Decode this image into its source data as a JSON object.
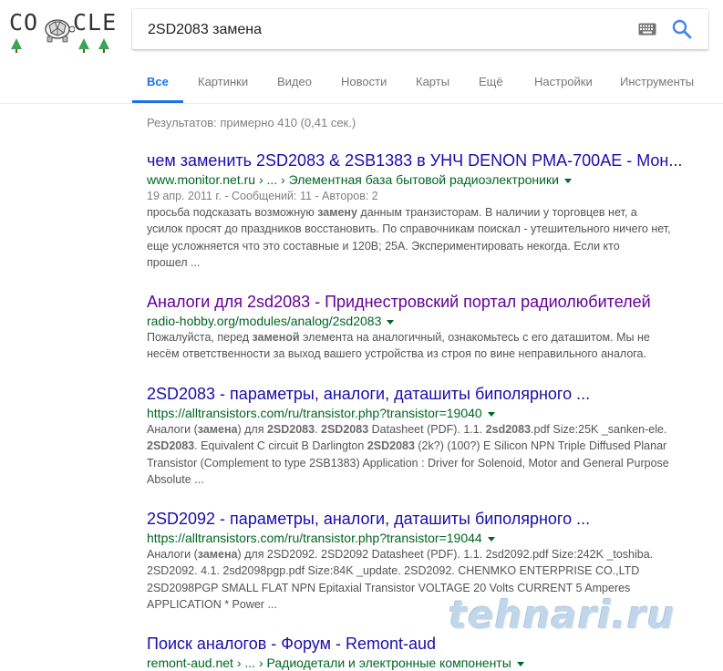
{
  "logo": {
    "left_text": "CO",
    "right_text": "CLE"
  },
  "search": {
    "query": "2SD2083 замена"
  },
  "tabs": [
    {
      "label": "Все"
    },
    {
      "label": "Картинки"
    },
    {
      "label": "Видео"
    },
    {
      "label": "Новости"
    },
    {
      "label": "Карты"
    },
    {
      "label": "Ещё"
    },
    {
      "label": "Настройки"
    },
    {
      "label": "Инструменты"
    }
  ],
  "stats": "Результатов: примерно 410 (0,41 сек.)",
  "results": [
    {
      "title": "чем заменить 2SD2083 & 2SB1383 в УНЧ DENON PMA-700AE - Мон...",
      "url": "www.monitor.net.ru › ... › Элементная база бытовой радиоэлектроники",
      "meta": "19 апр. 2011 г. - Сообщений: 11 - Авторов: 2",
      "snippet": [
        [
          "просьба подсказать возможную ",
          "замену",
          " данным транзисторам. В наличии у торговцев нет, а"
        ],
        [
          "усилок просят до праздников восстановить. По справочникам поискал - утешительного ничего нет,"
        ],
        [
          "еще усложняется что это составные и 120В; 25А. Экспериментировать некогда. Если кто"
        ],
        [
          "прошел ..."
        ]
      ]
    },
    {
      "title": "Аналоги для 2sd2083 - Приднестровский портал радиолюбителей",
      "url": "radio-hobby.org/modules/analog/2sd2083",
      "snippet": [
        [
          "Пожалуйста, перед ",
          "заменой",
          " элемента на аналогичный, ознакомьтесь с его даташитом. Мы не"
        ],
        [
          "несём ответственности за выход вашего устройства из строя по вине неправильного аналога."
        ]
      ]
    },
    {
      "title": "2SD2083 - параметры, аналоги, даташиты биполярного ...",
      "url": "https://alltransistors.com/ru/transistor.php?transistor=19040",
      "snippet": [
        [
          "Аналоги (",
          "замена",
          ") для ",
          "2SD2083",
          ". ",
          "2SD2083",
          " Datasheet (PDF). 1.1. ",
          "2sd2083",
          ".pdf Size:25K _sanken-ele."
        ],
        [
          "",
          "2SD2083",
          ". Equivalent C circuit B Darlington ",
          "2SD2083",
          " (2k?) (100?) E Silicon NPN Triple Diffused Planar"
        ],
        [
          "Transistor (Complement to type 2SB1383) Application : Driver for Solenoid, Motor and General Purpose"
        ],
        [
          "Absolute ..."
        ]
      ]
    },
    {
      "title": "2SD2092 - параметры, аналоги, даташиты биполярного ...",
      "url": "https://alltransistors.com/ru/transistor.php?transistor=19044",
      "snippet": [
        [
          "Аналоги (",
          "замена",
          ") для 2SD2092. 2SD2092 Datasheet (PDF). 1.1. 2sd2092.pdf Size:242K _toshiba."
        ],
        [
          "2SD2092. 4.1. 2sd2098pgp.pdf Size:84K _update. 2SD2092. CHENMKO ENTERPRISE CO.,LTD"
        ],
        [
          "2SD2098PGP SMALL FLAT NPN Epitaxial Transistor VOLTAGE 20 Volts CURRENT 5 Amperes"
        ],
        [
          "APPLICATION * Power ..."
        ]
      ]
    },
    {
      "title": "Поиск аналогов - Форум - Remont-aud",
      "url": "remont-aud.net › ... › Радиодетали и электронные компоненты"
    }
  ],
  "watermark": "tehnari.ru",
  "colors": {
    "link": "#1a0dab",
    "visited": "#660099",
    "url_green": "#006621",
    "accent": "#1a73e8"
  }
}
